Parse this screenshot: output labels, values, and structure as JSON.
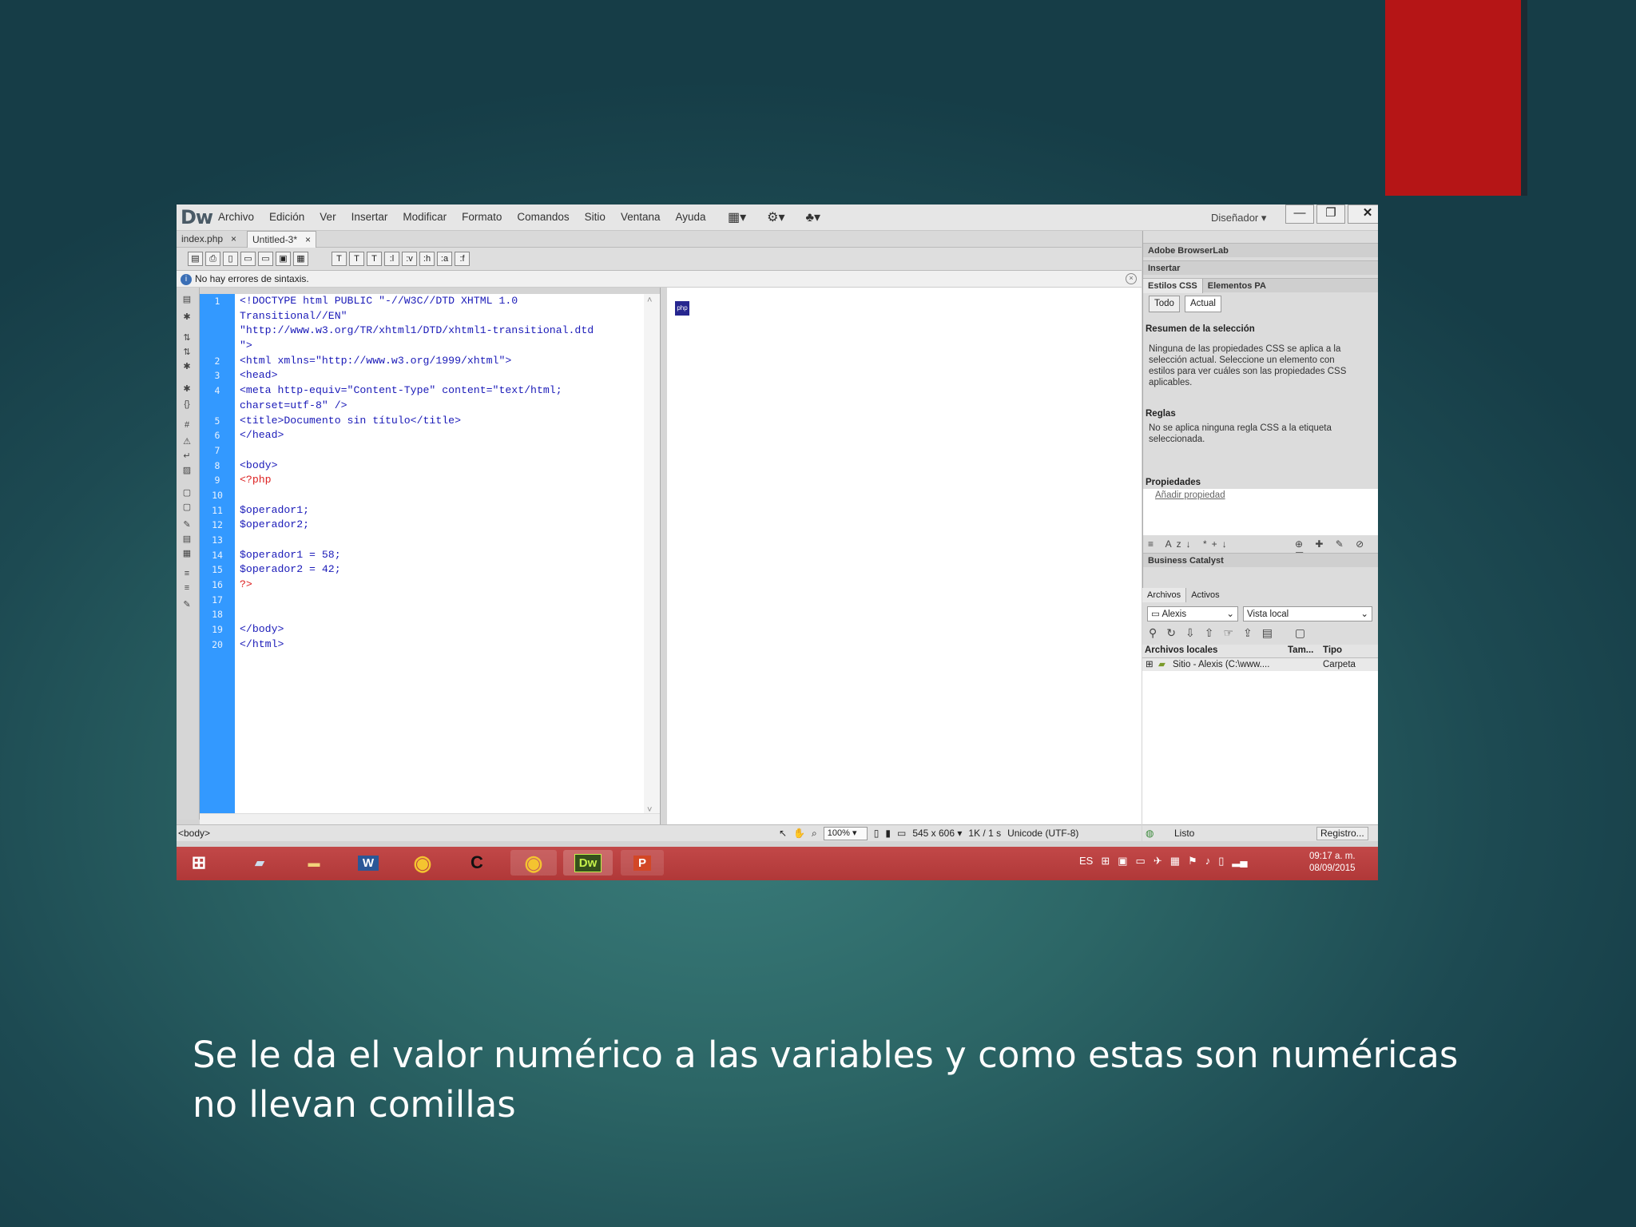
{
  "window": {
    "app_logo": "Dw",
    "menu": [
      "Archivo",
      "Edición",
      "Ver",
      "Insertar",
      "Modificar",
      "Formato",
      "Comandos",
      "Sitio",
      "Ventana",
      "Ayuda"
    ],
    "workspace": "Diseñador",
    "controls": {
      "minimize": "—",
      "restore": "❐",
      "close": "✕"
    }
  },
  "tabs": [
    {
      "label": "index.php",
      "close": "×"
    },
    {
      "label": "Untitled-3*",
      "close": "×"
    }
  ],
  "status_line": {
    "text": "No hay errores de sintaxis."
  },
  "editor": {
    "line_numbers": [
      "1",
      "",
      "",
      "",
      "2",
      "3",
      "4",
      "",
      "5",
      "6",
      "7",
      "8",
      "9",
      "10",
      "11",
      "12",
      "13",
      "14",
      "15",
      "16",
      "17",
      "18",
      "19",
      "20"
    ],
    "lines": [
      "<!DOCTYPE html PUBLIC \"-//W3C//DTD XHTML 1.0",
      "Transitional//EN\"",
      "\"http://www.w3.org/TR/xhtml1/DTD/xhtml1-transitional.dtd",
      "\">",
      "<html xmlns=\"http://www.w3.org/1999/xhtml\">",
      "<head>",
      "<meta http-equiv=\"Content-Type\" content=\"text/html;",
      "charset=utf-8\" />",
      "<title>Documento sin título</title>",
      "</head>",
      "",
      "<body>",
      "<?php",
      "",
      "$operador1;",
      "$operador2;",
      "",
      "$operador1 = 58;",
      "$operador2 = 42;",
      "?>",
      "",
      "",
      "</body>",
      "</html>"
    ]
  },
  "doc_status": {
    "tag": "<body>",
    "zoom": "100%",
    "size": "545 x 606",
    "weight": "1K / 1 s",
    "encoding": "Unicode (UTF-8)"
  },
  "panels": {
    "browserlab": "Adobe BrowserLab",
    "insertar": "Insertar",
    "css_tab": "Estilos CSS",
    "ap_tab": "Elementos PA",
    "todo": "Todo",
    "actual": "Actual",
    "resumen_title": "Resumen de la selección",
    "resumen_text": "Ninguna de las propiedades CSS se aplica a la selección actual.  Seleccione un elemento con estilos para ver cuáles son las propiedades CSS aplicables.",
    "reglas_title": "Reglas",
    "reglas_text": "No se aplica ninguna regla CSS a la etiqueta seleccionada.",
    "propiedades_title": "Propiedades",
    "add_prop": "Añadir propiedad",
    "business": "Business Catalyst",
    "archivos_tab": "Archivos",
    "activos_tab": "Activos",
    "site": "Alexis",
    "view": "Vista local",
    "col_files": "Archivos locales",
    "col_size": "Tam...",
    "col_type": "Tipo",
    "row_name": "Sitio - Alexis (C:\\www....",
    "row_type": "Carpeta",
    "status": "Listo",
    "registro": "Registro..."
  },
  "taskbar": {
    "word": "W",
    "dw": "Dw",
    "ppt": "P",
    "lang": "ES",
    "time": "09:17 a. m.",
    "date": "08/09/2015"
  },
  "caption": {
    "line1": "Se le da el valor numérico a las variables y como estas son numéricas",
    "line2": "no llevan comillas"
  },
  "colors": {
    "accent_red": "#b51516",
    "gutter_blue": "#3399ff",
    "code_blue": "#1a1ab8",
    "php_red": "#d22222"
  }
}
